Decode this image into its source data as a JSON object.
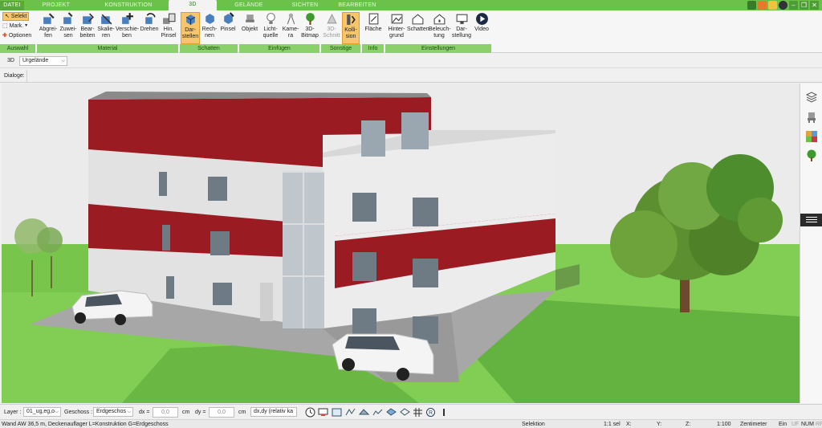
{
  "tabs": [
    {
      "label": "DATEI"
    },
    {
      "label": "PROJEKT"
    },
    {
      "label": "KONSTRUKTION"
    },
    {
      "label": "3D"
    },
    {
      "label": "GELÄNDE"
    },
    {
      "label": "SICHTEN"
    },
    {
      "label": "BEARBEITEN"
    }
  ],
  "window_controls": {
    "minimize": "–",
    "restore": "❐",
    "close": "✕"
  },
  "ribbon": {
    "auswahl": {
      "selekt": "Selekt",
      "mark": "Mark.",
      "optionen": "Optionen",
      "group": "Auswahl"
    },
    "material": {
      "buttons": [
        "Abgrei-\nfen",
        "Zuwei-\nsen",
        "Bear-\nbeiten",
        "Skalie-\nren",
        "Verschie-\nben",
        "Drehen",
        "Hin.\nPinsel"
      ],
      "group": "Material"
    },
    "schatten": {
      "buttons": [
        "Dar-\nstellen",
        "Rech-\nnen",
        "Pinsel"
      ],
      "group": "Schatten"
    },
    "einfuegen": {
      "buttons": [
        "Objekt",
        "Licht-\nquelle",
        "Kame-\nra",
        "3D-\nBitmap"
      ],
      "group": "Einfügen"
    },
    "sonstige": {
      "buttons": [
        "3D-\nSchnitt",
        "Kolli-\nsion"
      ],
      "group": "Sonstige"
    },
    "info": {
      "buttons": [
        "Fläche"
      ],
      "group": "Info"
    },
    "einstellungen": {
      "buttons": [
        "Hinter-\ngrund",
        "Schatten",
        "Beleuch-\ntung",
        "Dar-\nstellung",
        "Video"
      ],
      "group": "Einstellungen"
    }
  },
  "row1": {
    "prefix": "3D",
    "view_select": "Urgelände"
  },
  "row2": {
    "dialoge_label": "Dialoge:"
  },
  "bottom": {
    "layer_label": "Layer :",
    "layer_value": "01_ug,eg,o",
    "geschoss_label": "Geschoss :",
    "geschoss_value": "Erdgeschos",
    "dx_label": "dx =",
    "dx_value": "0,0",
    "dx_unit": "cm",
    "dy_label": "dy =",
    "dy_value": "0,0",
    "dy_unit": "cm",
    "mode_value": "dx,dy (relativ ka"
  },
  "status": {
    "info": "Wand AW 36,5 m, Deckenauflager L=Konstruktion G=Erdgeschoss",
    "mode": "Selektion",
    "sel": "1:1 sel",
    "x": "X:",
    "y": "Y:",
    "z": "Z:",
    "scale": "1:100",
    "unit": "Zentimeter",
    "ein": "Ein",
    "uf": "UF",
    "num": "NUM",
    "rf": "RF"
  },
  "colors": {
    "green": "#6cc14a",
    "group_green": "#8bd06a",
    "red_band": "#9b1b22",
    "wall": "#e4e4e4",
    "grass": "#7fcc52",
    "sky": "#e9e9e9"
  }
}
